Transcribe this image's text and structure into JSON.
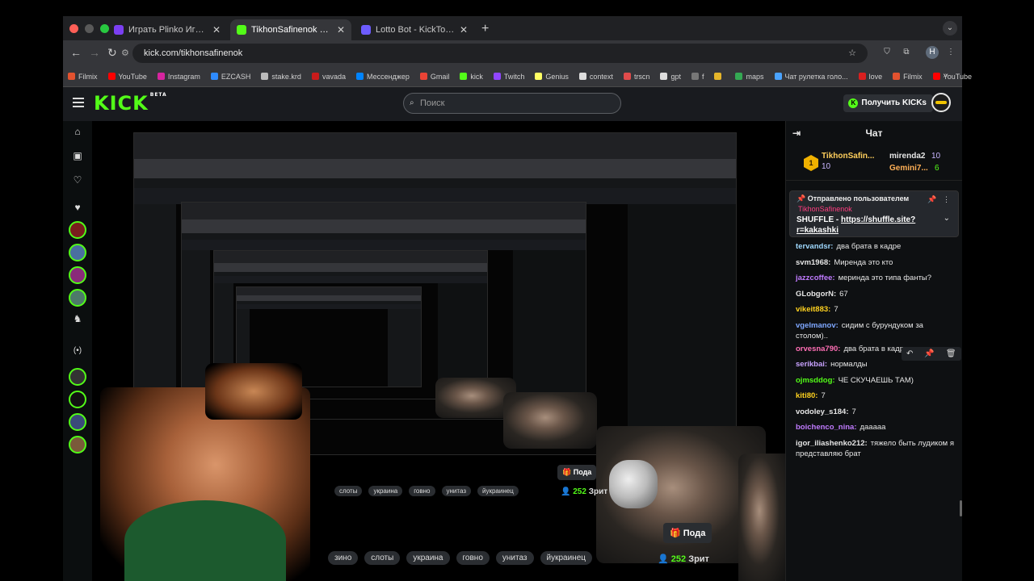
{
  "tabs": [
    {
      "title": "Играть Plinko Игра | Shuffle",
      "color": "#7b3ff2"
    },
    {
      "title": "TikhonSafinenok Stream - Wa",
      "color": "#53fc18"
    },
    {
      "title": "Lotto Bot - KickTools",
      "color": "#6d5cff"
    }
  ],
  "address": {
    "url": "kick.com/tikhonsafinenok"
  },
  "bookmarks": [
    {
      "label": "Filmix",
      "color": "#e2522f"
    },
    {
      "label": "YouTube",
      "color": "#ff0000"
    },
    {
      "label": "Instagram",
      "color": "#d6249f"
    },
    {
      "label": "EZCASH",
      "color": "#2e8bff"
    },
    {
      "label": "stake.krd",
      "color": "#bbbbbb"
    },
    {
      "label": "vavada",
      "color": "#c81b1b"
    },
    {
      "label": "Мессенджер",
      "color": "#0084ff"
    },
    {
      "label": "Gmail",
      "color": "#ea4335"
    },
    {
      "label": "kick",
      "color": "#53fc18"
    },
    {
      "label": "Twitch",
      "color": "#9146ff"
    },
    {
      "label": "Genius",
      "color": "#ffff64"
    },
    {
      "label": "context",
      "color": "#dddddd"
    },
    {
      "label": "trscn",
      "color": "#e04b4b"
    },
    {
      "label": "gpt",
      "color": "#dddddd"
    },
    {
      "label": "f",
      "color": "#777777"
    },
    {
      "label": "",
      "color": "#e5b52a"
    },
    {
      "label": "maps",
      "color": "#34a853"
    },
    {
      "label": "Чат рулетка голо...",
      "color": "#4aa3ff"
    },
    {
      "label": "love",
      "color": "#d91f1f"
    },
    {
      "label": "Filmix",
      "color": "#e2522f"
    },
    {
      "label": "YouTube",
      "color": "#ff0000"
    }
  ],
  "header": {
    "logo": "KICK",
    "logo_badge": "BETA",
    "search_placeholder": "Поиск",
    "get_kicks": "Получить KICKs"
  },
  "stream": {
    "tags_large": [
      "зино",
      "слоты",
      "украина",
      "говно",
      "унитаз",
      "йукраинец"
    ],
    "tags_medium": [
      "слоты",
      "украина",
      "говно",
      "унитаз",
      "йукраинец"
    ],
    "subscribe_large": "Пода",
    "subscribe_medium": "Пода",
    "viewers_large": "252",
    "viewers_large_suffix": "Зрит",
    "viewers_medium": "252",
    "viewers_medium_suffix": "Зрит"
  },
  "chat": {
    "title": "Чат",
    "leaderboard": {
      "rank": "1",
      "first_name": "TikhonSafin...",
      "first_count": "10",
      "second_name": "mirenda2",
      "second_count": "10",
      "third_name": "Gemini7...",
      "third_count": "6"
    },
    "pinned": {
      "title": "Отправлено пользователем",
      "user": "TikhonSafinenok",
      "message_prefix": "SHUFFLE - ",
      "link": "https://shuffle.site?r=kakashki"
    },
    "messages": [
      {
        "user": "tervandsr:",
        "text": "два брата в кадре",
        "color": "#9fd9ff"
      },
      {
        "user": "svm1968:",
        "text": "Миренда это кто",
        "color": "#e6e6e6"
      },
      {
        "user": "jazzcoffee:",
        "text": "меринда это типа фанты?",
        "color": "#c07bff"
      },
      {
        "user": "GLobgorN:",
        "text": "67",
        "color": "#e6e6e6"
      },
      {
        "user": "vikeit883:",
        "text": "7",
        "color": "#ffd21f"
      },
      {
        "user": "vgelmanov:",
        "text": "сидим с бурундуком за столом)..",
        "color": "#7ea7ff"
      },
      {
        "user": "orvesna790:",
        "text": "два брата в кадре да",
        "color": "#ff6fb5"
      },
      {
        "user": "serikbai:",
        "text": "нормалды",
        "color": "#c8a2ff"
      },
      {
        "user": "ojmsddog:",
        "text": "ЧЕ СКУЧАЕШЬ ТАМ)",
        "color": "#53fc18"
      },
      {
        "user": "kiti80:",
        "text": "7",
        "color": "#ffd21f"
      },
      {
        "user": "vodoley_s184:",
        "text": "7",
        "color": "#e6e6e6"
      },
      {
        "user": "boichenco_nina:",
        "text": "дааааа",
        "color": "#c07bff"
      },
      {
        "user": "igor_iliashenko212:",
        "text": "тяжело быть лудиком я представляю брат",
        "color": "#e6e6e6"
      }
    ]
  }
}
